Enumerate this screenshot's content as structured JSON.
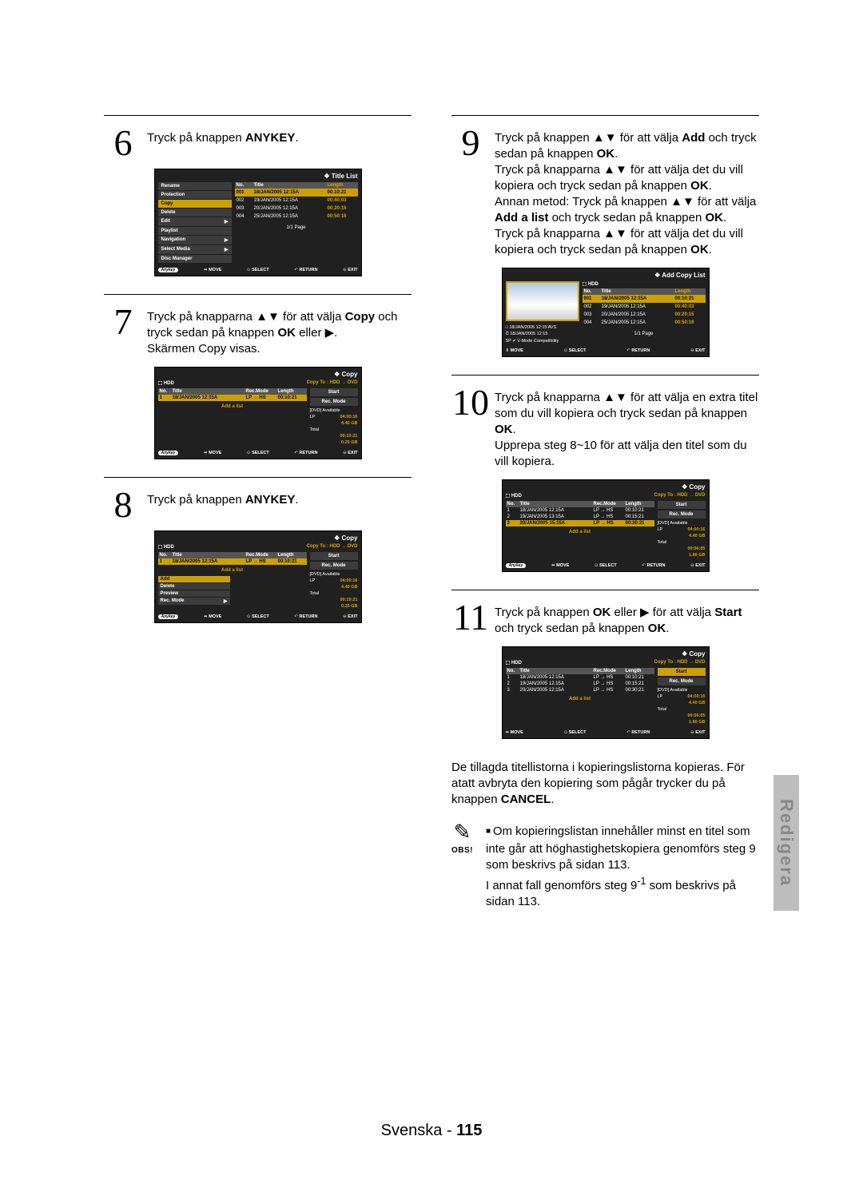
{
  "side_tab": "Redigera",
  "footer": {
    "lang": "Svenska",
    "sep": " - ",
    "page": "115"
  },
  "note_label": "OBS!",
  "ui": {
    "title_list": "Title List",
    "copy": "Copy",
    "add_copy_list": "Add Copy List",
    "hdd": "HDD",
    "copy_to": "Copy To : HDD → DVD",
    "page_ind": "1/1 Page",
    "foot_move": "MOVE",
    "foot_select": "SELECT",
    "foot_return": "RETURN",
    "foot_exit": "EXIT",
    "anykey": "Anykey",
    "cols": {
      "no": "No.",
      "title": "Title",
      "length": "Length",
      "recmode": "Rec.Mode"
    },
    "menu6": [
      "Rename",
      "Protection",
      "Copy",
      "Delete",
      "Edit",
      "Playlist",
      "Navigation",
      "Select Media",
      "Disc Manager"
    ],
    "menu8": [
      "Add",
      "Delete",
      "Preview",
      "Rec. Mode"
    ],
    "btns": {
      "start": "Start",
      "recmode": "Rec. Mode"
    },
    "availability": {
      "dvd": "[DVD] Available",
      "lp": "LP",
      "lp_time": "04:00:16",
      "lp_size": "4.40 GB",
      "total": "Total",
      "total_time_1": "00:10:21",
      "total_size_1": "0.25 GB",
      "total_time_3": "00:56:05",
      "total_size_3": "1.80 GB"
    },
    "add_a_list": "Add a list",
    "titles4": [
      {
        "no": "001",
        "title": "18/JAN/2005 12:15A",
        "len": "00:10:21"
      },
      {
        "no": "002",
        "title": "19/JAN/2005 12:15A",
        "len": "00:40:03"
      },
      {
        "no": "003",
        "title": "20/JAN/2005 12:15A",
        "len": "00:20:15"
      },
      {
        "no": "004",
        "title": "25/JAN/2005 12:15A",
        "len": "00:50:16"
      }
    ],
    "copy1": [
      {
        "no": "1",
        "title": "18/JAN/2005 12:15A",
        "rm": "LP → HS",
        "len": "00:10:21"
      }
    ],
    "copy3": [
      {
        "no": "1",
        "title": "18/JAN/2005 12:15A",
        "rm": "LP → HS",
        "len": "00:10:21"
      },
      {
        "no": "2",
        "title": "19/JAN/2005 13:15A",
        "rm": "LP → HS",
        "len": "00:15:21"
      },
      {
        "no": "3",
        "title": "20/JAN/2005 15:15A",
        "rm": "LP → HS",
        "len": "00:30:21"
      }
    ],
    "copy3b": [
      {
        "no": "1",
        "title": "18/JAN/2005 12:15A",
        "rm": "LP → HS",
        "len": "00:10:21"
      },
      {
        "no": "2",
        "title": "19/JAN/2005 12:15A",
        "rm": "LP → HS",
        "len": "00:15:21"
      },
      {
        "no": "3",
        "title": "20/JAN/2005 12:15A",
        "rm": "LP → HS",
        "len": "00:30:21"
      }
    ],
    "addcopy_sub1": "18/JAN/2005 12:15 AVS",
    "addcopy_sub2": "18/JAN/2005 12:15",
    "addcopy_sub3": "SP ✔ V-Mode Compatibility"
  },
  "steps": {
    "s6": {
      "num": "6",
      "html": "Tryck på knappen <b>ANYKEY</b>."
    },
    "s7": {
      "num": "7",
      "html": "Tryck på knapparna ▲▼ för att välja <b>Copy</b> och tryck sedan på knappen <b>OK</b> eller ▶.<br>Skärmen Copy visas."
    },
    "s8": {
      "num": "8",
      "html": "Tryck på knappen <b>ANYKEY</b>."
    },
    "s9": {
      "num": "9",
      "html": "Tryck på knappen ▲▼ för att välja <b>Add</b> och tryck sedan på knappen <b>OK</b>.<br>Tryck på knapparna ▲▼ för att välja det du vill kopiera och tryck sedan på knappen <b>OK</b>.<br>Annan metod: Tryck på knappen ▲▼ för att välja <b>Add a list</b> och tryck sedan på knappen <b>OK</b>.<br>Tryck på knapparna ▲▼ för att välja det du vill kopiera och tryck sedan på knappen <b>OK</b>."
    },
    "s10": {
      "num": "10",
      "html": "Tryck på knapparna ▲▼ för att välja en extra titel som du vill kopiera och tryck sedan på knappen <b>OK</b>.<br>Upprepa steg 8~10 för att välja den titel som du vill kopiera."
    },
    "s11": {
      "num": "11",
      "html": "Tryck på knappen <b>OK</b> eller ▶ för att välja <b>Start</b> och tryck sedan på knappen <b>OK</b>."
    },
    "after11": "De tillagda titellistorna i kopieringslistorna kopieras. För atatt avbryta den kopiering som pågår trycker du på knappen <b>CANCEL</b>."
  },
  "note": {
    "text": "Om kopieringslistan innehåller minst en titel som inte går att höghastighetskopiera genomförs steg 9 som beskrivs på sidan 113.<br>I annat fall genomförs steg 9<sup>-1</sup> som beskrivs på sidan 113."
  }
}
